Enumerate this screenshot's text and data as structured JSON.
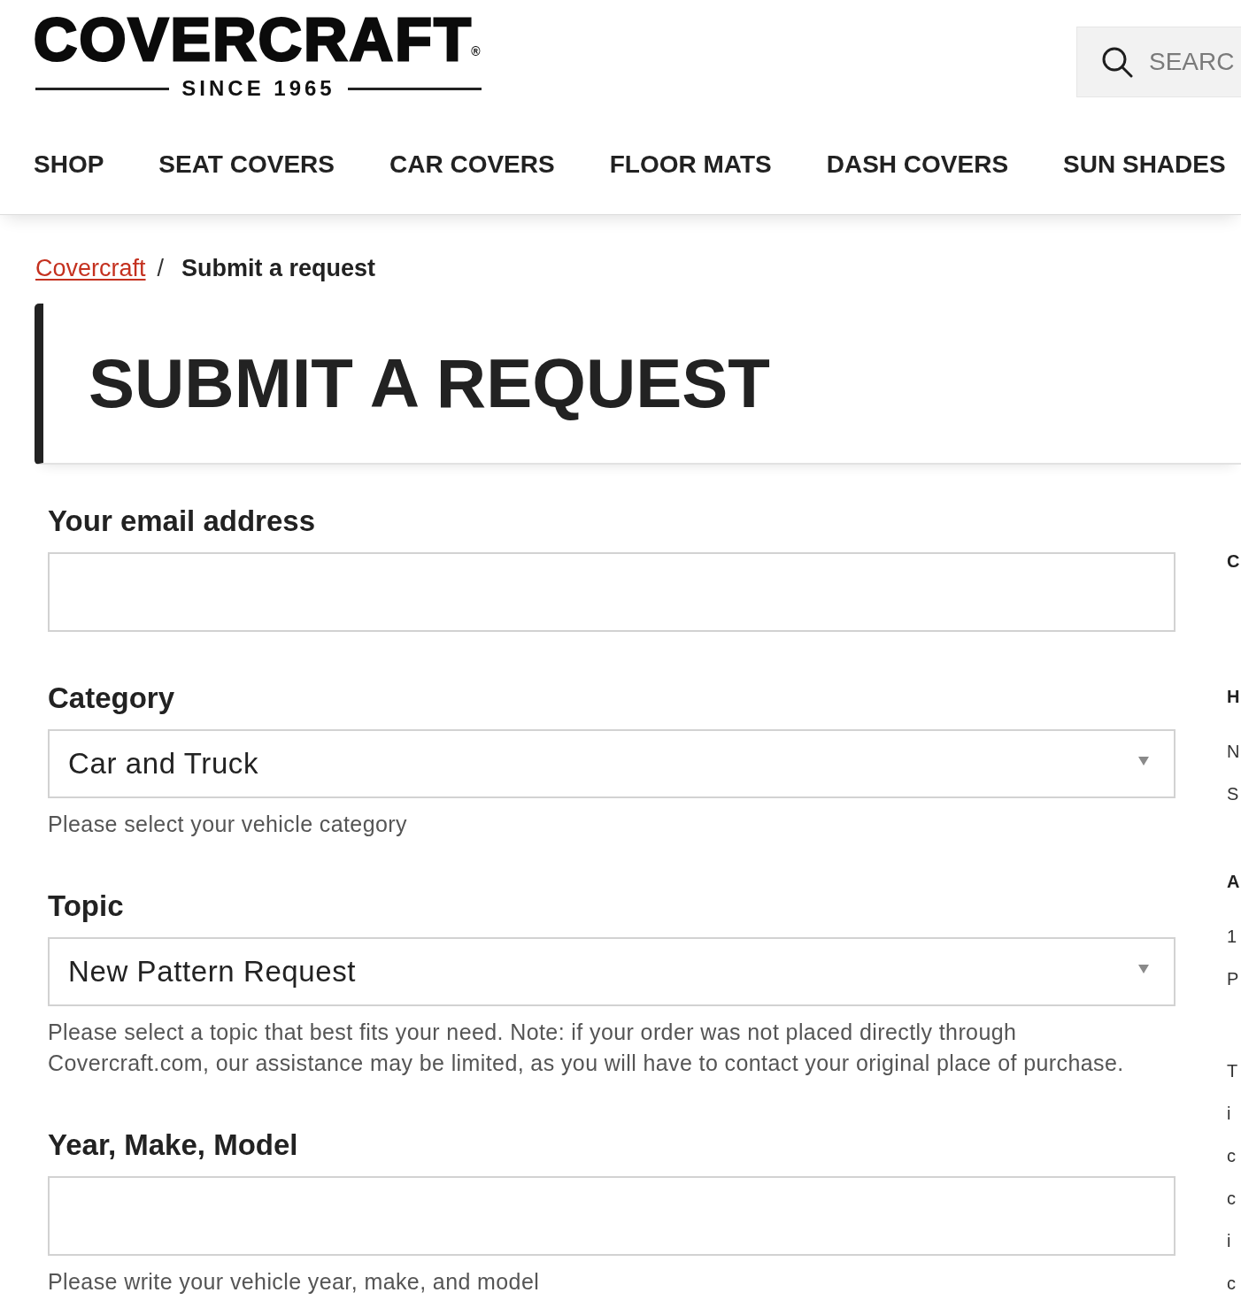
{
  "header": {
    "logo": {
      "wordmark": "COVERCRAFT",
      "registered": "®",
      "tagline": "SINCE 1965"
    },
    "search": {
      "placeholder": "SEARC"
    }
  },
  "nav": [
    "SHOP",
    "SEAT COVERS",
    "CAR COVERS",
    "FLOOR MATS",
    "DASH COVERS",
    "SUN SHADES"
  ],
  "breadcrumb": [
    {
      "label": "Covercraft",
      "kind": "link"
    },
    {
      "label": "Submit a request",
      "kind": "current"
    }
  ],
  "breadcrumb_separator": "/",
  "page_title": "SUBMIT A REQUEST",
  "form": {
    "fields": [
      {
        "kind": "text",
        "label": "Your email address"
      },
      {
        "kind": "select",
        "label": "Category",
        "value": "Car and Truck",
        "hint": "Please select your vehicle category"
      },
      {
        "kind": "select",
        "label": "Topic",
        "value": "New Pattern Request",
        "hint": "Please select a topic that best fits your need. Note: if your order was not placed directly through Covercraft.com, our assistance may be limited, as you will have to contact your original place of purchase."
      },
      {
        "kind": "text",
        "label": "Year, Make, Model",
        "hint": "Please write your vehicle year, make, and model"
      }
    ]
  },
  "sidebar": {
    "title": "C",
    "sections": [
      {
        "heading": "H",
        "lines": [
          "N",
          "S"
        ]
      },
      {
        "heading": "A",
        "lines": [
          "1",
          "P"
        ]
      },
      {
        "lines": [
          "T",
          "i",
          "c",
          "c",
          "i",
          "c"
        ]
      }
    ]
  }
}
